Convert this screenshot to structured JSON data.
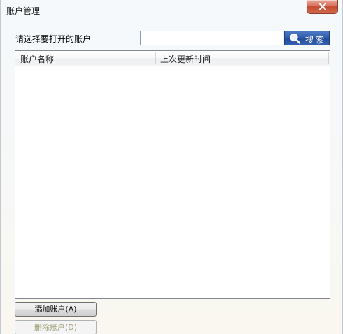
{
  "window": {
    "title": "账户管理"
  },
  "prompt": {
    "label": "请选择要打开的账户"
  },
  "search": {
    "value": "",
    "button_label": "搜索"
  },
  "accounts_table": {
    "columns": [
      "账户名称",
      "上次更新时间"
    ],
    "rows": []
  },
  "actions": {
    "add_label": "添加账户(A)",
    "delete_label": "删除账户(D)"
  },
  "colors": {
    "close_button": "#c44a31",
    "search_button": "#2f5aa9",
    "disabled_text": "#a0a078"
  },
  "icons": {
    "close": "close-icon",
    "search": "search-icon"
  }
}
